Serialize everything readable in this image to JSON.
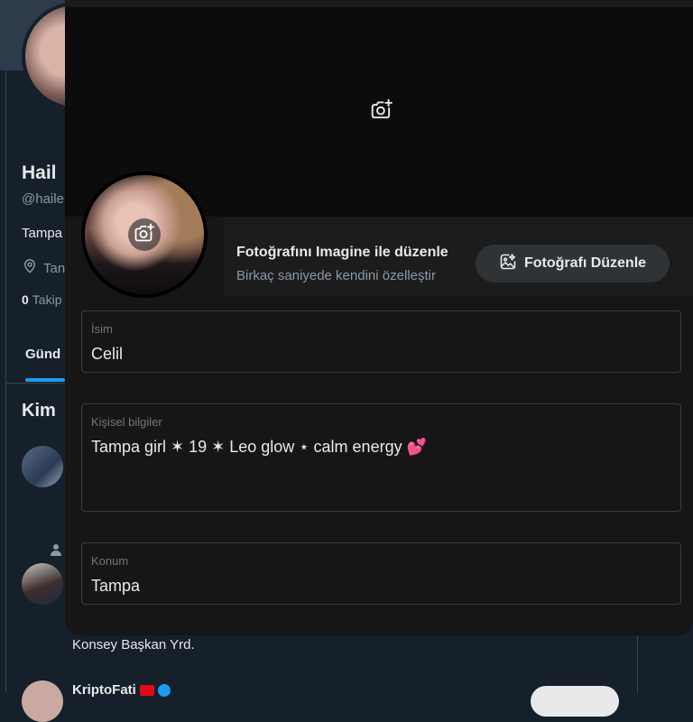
{
  "background": {
    "name": "Hail",
    "handle": "@haile",
    "bio": "Tampa",
    "location": "Tan",
    "followers_count": "0",
    "followers_label": "Takip",
    "tab": "Günd",
    "section_title": "Kim",
    "suggestion_text": "Konsey Başkan Yrd.",
    "suggestion_name": "KriptoFati"
  },
  "modal": {
    "imagine": {
      "title": "Fotoğrafını Imagine ile düzenle",
      "subtitle": "Birkaç saniyede kendini özelleştir",
      "button_label": "Fotoğrafı Düzenle"
    },
    "fields": {
      "name": {
        "label": "İsim",
        "value": "Celil"
      },
      "bio": {
        "label": "Kişisel bilgiler",
        "value": "Tampa girl ✶ 19 ✶ Leo glow ⋆ calm energy 💕"
      },
      "location": {
        "label": "Konum",
        "value": "Tampa"
      }
    }
  },
  "colors": {
    "accent": "#1d9bf0",
    "modal_bg": "#161616",
    "page_bg": "#15202b"
  },
  "icons": [
    "camera-plus-icon",
    "image-edit-icon",
    "location-pin-icon",
    "person-icon"
  ]
}
